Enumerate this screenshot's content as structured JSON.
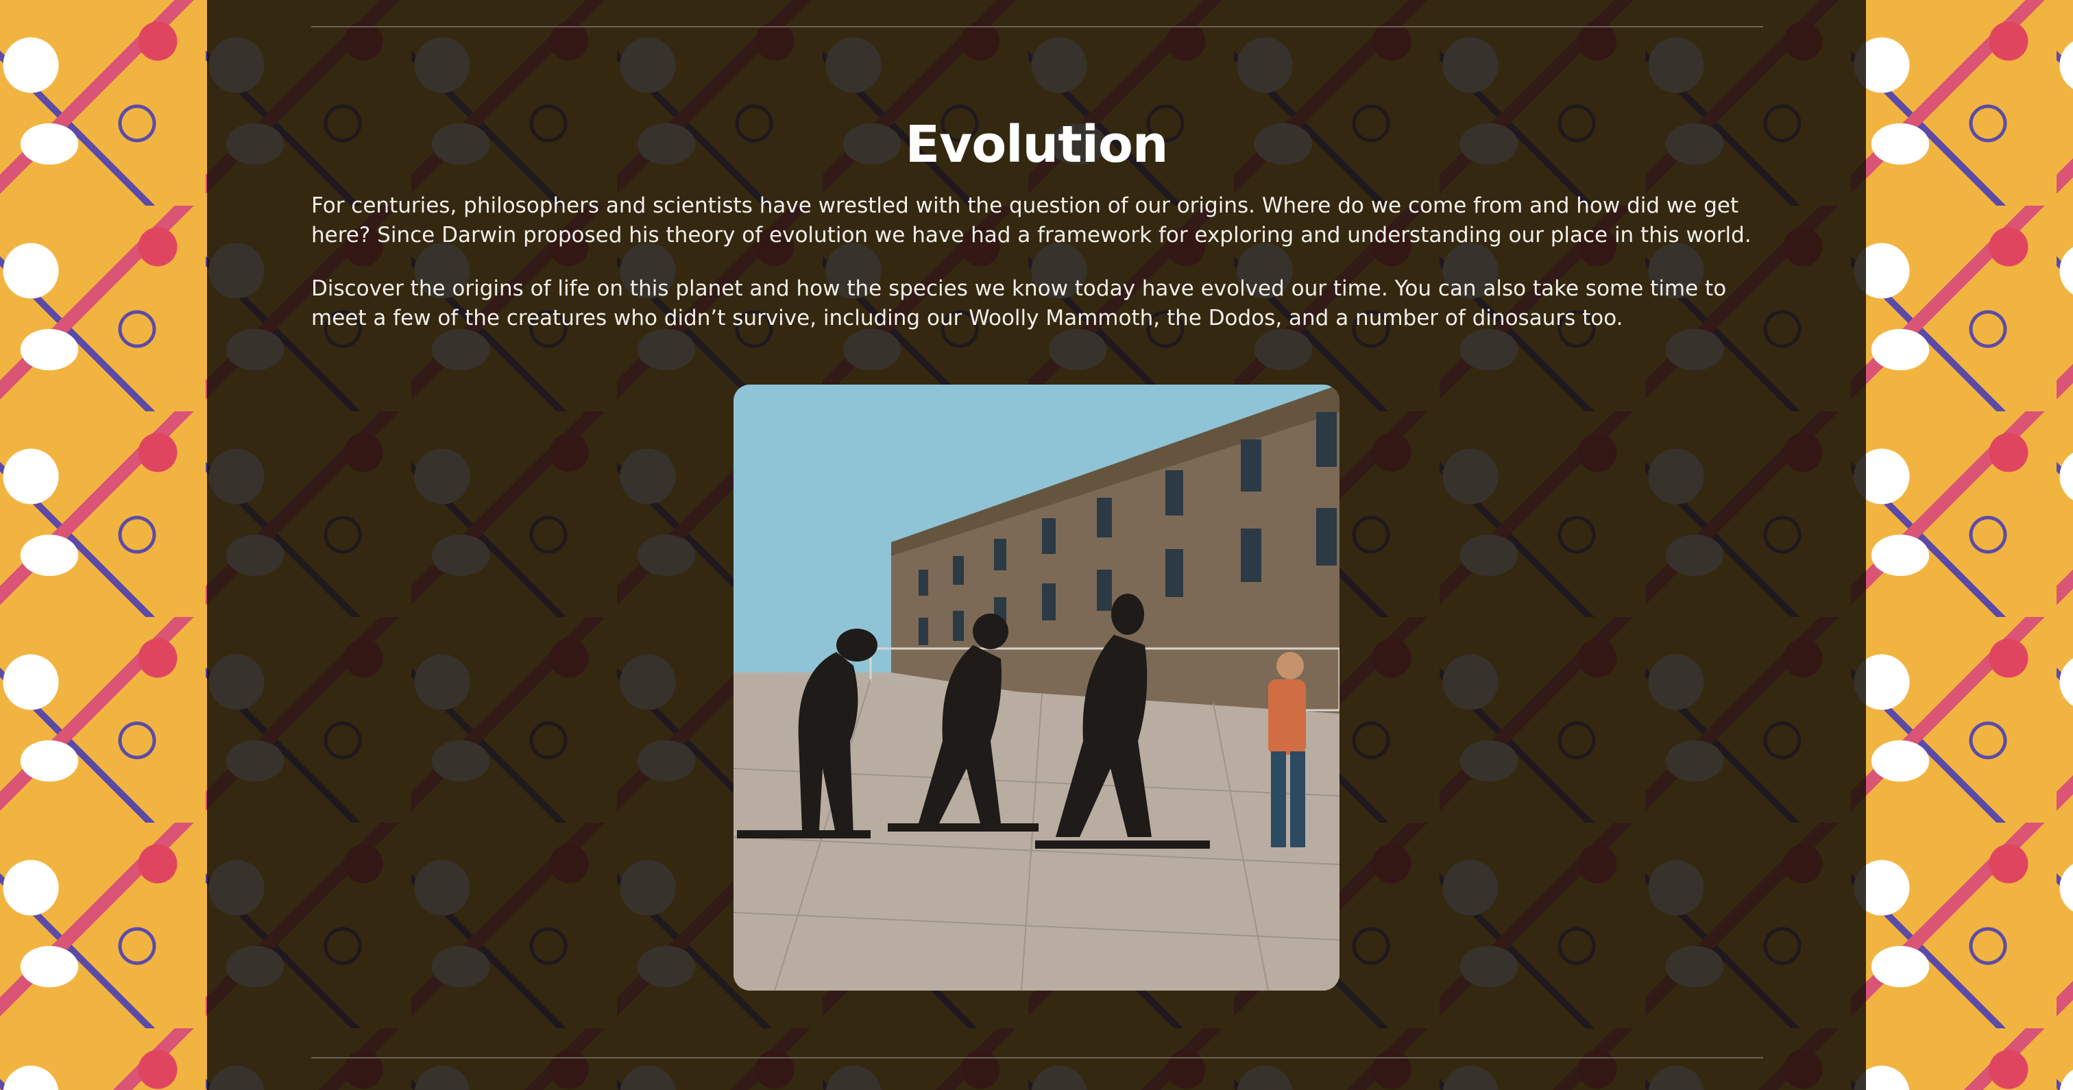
{
  "page": {
    "title": "Evolution",
    "paragraphs": [
      "For centuries, philosophers and scientists have wrestled with the question of our origins. Where do we come from and how did we get here? Since Darwin proposed his theory of evolution we have had a framework for exploring and understanding our place in this world.",
      "Discover the origins of life on this planet and how the species we know today have evolved our time. You can also take some time to meet a few of the creatures who didn’t survive, including our Woolly Mammoth, the Dodos, and a number of dinosaurs too."
    ]
  },
  "colors": {
    "background_pattern": "#f2b440",
    "panel": "#161008",
    "text": "#ffffff",
    "accent_pink": "#e0455f",
    "accent_purple": "#5b4aa8"
  },
  "icons": [
    "flask-icon",
    "palette-icon",
    "triangle-ruler-icon",
    "paperclip-icon",
    "heart-notepad-icon",
    "pencil-icon"
  ]
}
